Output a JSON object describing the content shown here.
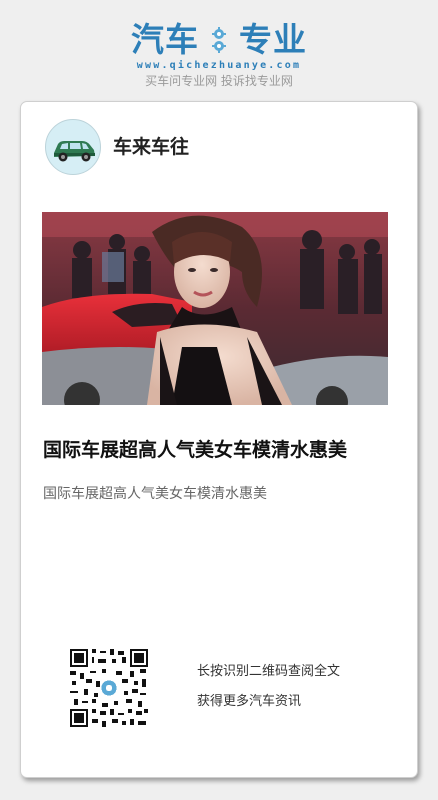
{
  "brand": {
    "name_left": "汽车",
    "name_right": "专业",
    "url": "www.qichezhuanye.com",
    "slogan": "买车问专业网 投诉找专业网",
    "color": "#2d7fb8"
  },
  "post": {
    "author": "车来车往",
    "avatar_icon": "car-icon",
    "title": "国际车展超高人气美女车模清水惠美",
    "summary": "国际车展超高人气美女车模清水惠美"
  },
  "qr": {
    "line1": "长按识别二维码查阅全文",
    "line2": "获得更多汽车资讯"
  }
}
